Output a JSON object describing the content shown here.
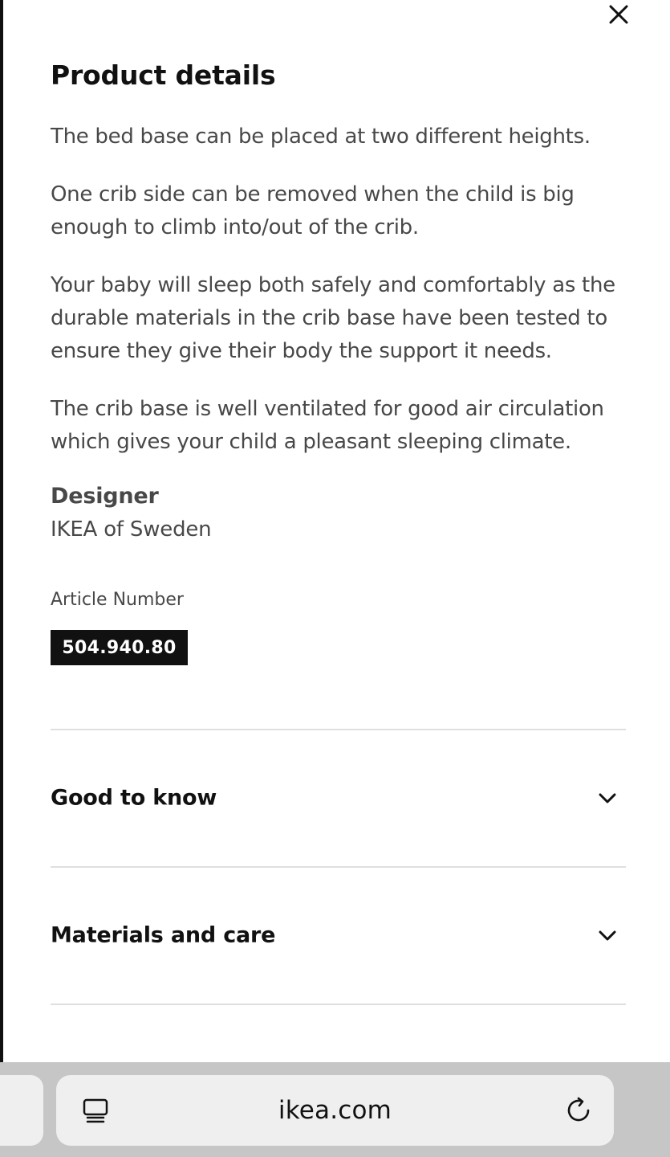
{
  "panel": {
    "title": "Product details",
    "paragraphs": [
      "The bed base can be placed at two different heights.",
      "One crib side can be removed when the child is big enough to climb into/out of the crib.",
      "Your baby will sleep both safely and comfortably as the durable materials in the crib base have been tested to ensure they give their body the support it needs.",
      "The crib base is well ventilated for good air circulation which gives your child a pleasant sleeping climate."
    ],
    "designer_label": "Designer",
    "designer_value": "IKEA of Sweden",
    "article_label": "Article Number",
    "article_number": "504.940.80",
    "accordions": [
      {
        "label": "Good to know",
        "icon": "chevron-down-icon"
      },
      {
        "label": "Materials and care",
        "icon": "chevron-down-icon"
      }
    ],
    "close_icon": "close-icon"
  },
  "browser": {
    "url": "ikea.com",
    "left_icon": "reader-mode-icon",
    "right_icon": "reload-icon"
  },
  "colors": {
    "text_primary": "#111111",
    "text_body": "#484848",
    "badge_bg": "#111111",
    "divider": "#dfdfdf",
    "browser_bar": "#c6c6c6"
  }
}
